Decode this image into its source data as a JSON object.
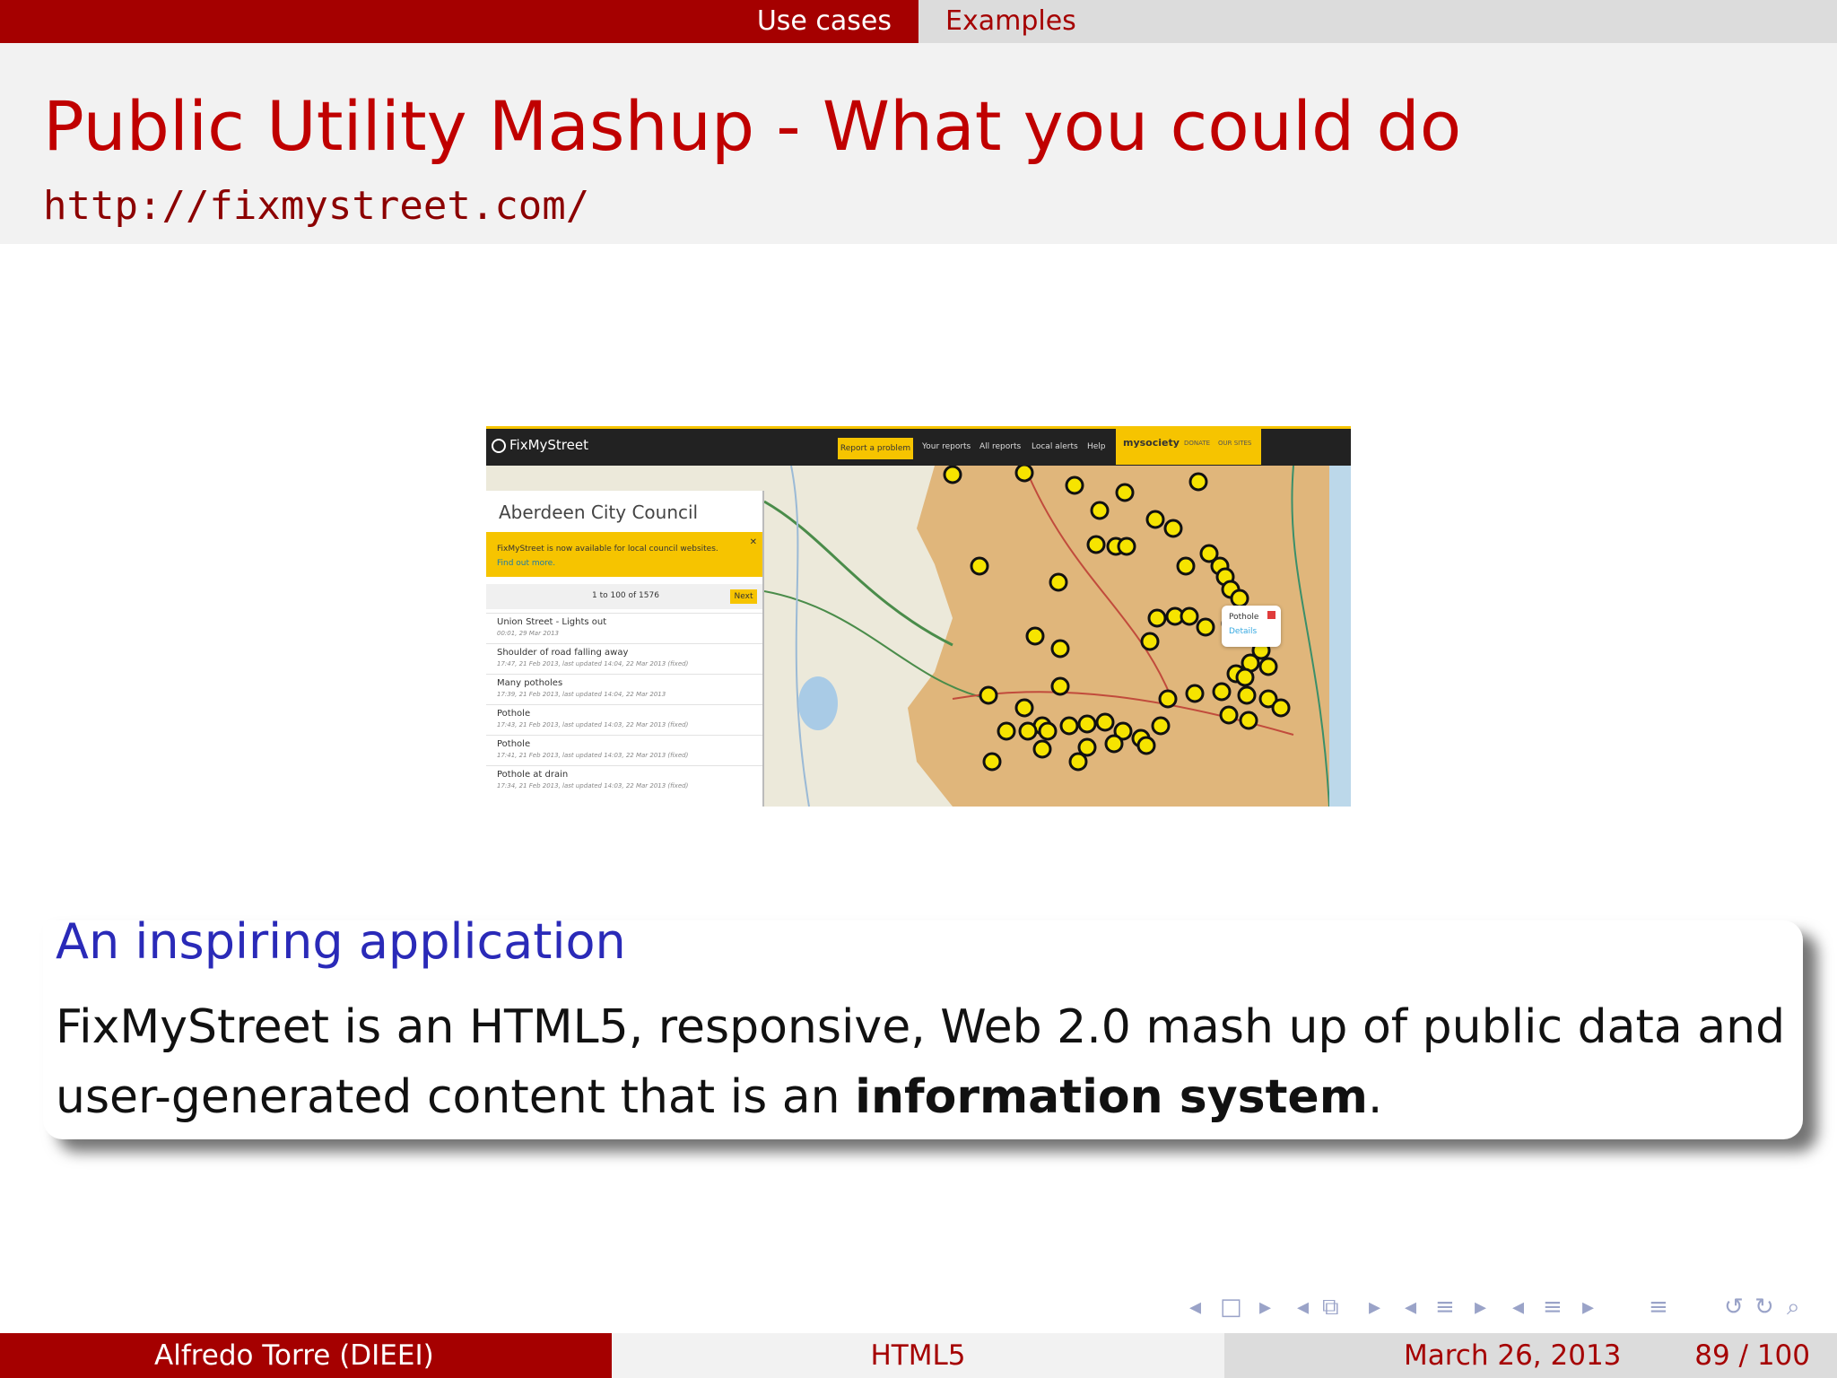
{
  "nav": {
    "section": "Use cases",
    "subsection": "Examples"
  },
  "title": "Public Utility Mashup - What you could do",
  "subtitle": "http://fixmystreet.com/",
  "screenshot": {
    "logo": "FixMyStreet",
    "nav": [
      "Report a problem",
      "Your reports",
      "All reports",
      "Local alerts",
      "Help"
    ],
    "mysociety": "mysociety",
    "mysociety_links": [
      "DONATE",
      "OUR SITES"
    ],
    "council": "Aberdeen City Council",
    "notice": "FixMyStreet is now available for local council websites.",
    "notice_link": "Find out more.",
    "pager": "1 to 100 of 1576",
    "next": "Next",
    "reports": [
      {
        "title": "Union Street - Lights out",
        "meta": "00:01, 29 Mar 2013"
      },
      {
        "title": "Shoulder of road falling away",
        "meta": "17:47, 21 Feb 2013, last updated 14:04, 22 Mar 2013 (fixed)"
      },
      {
        "title": "Many potholes",
        "meta": "17:39, 21 Feb 2013, last updated 14:04, 22 Mar 2013"
      },
      {
        "title": "Pothole",
        "meta": "17:43, 21 Feb 2013, last updated 14:03, 22 Mar 2013 (fixed)"
      },
      {
        "title": "Pothole",
        "meta": "17:41, 21 Feb 2013, last updated 14:03, 22 Mar 2013 (fixed)"
      },
      {
        "title": "Pothole at drain",
        "meta": "17:34, 21 Feb 2013, last updated 14:03, 22 Mar 2013 (fixed)"
      }
    ],
    "popup_title": "Pothole",
    "popup_link": "Details"
  },
  "block": {
    "title": "An inspiring application",
    "body_prefix": "FixMyStreet is an HTML5, responsive, Web 2.0 mash up of public data and user-generated content that is an ",
    "body_bold": "information system",
    "body_suffix": "."
  },
  "footer": {
    "author": "Alfredo Torre  (DIEEI)",
    "short_title": "HTML5",
    "date": "March 26, 2013",
    "page": "89 / 100"
  },
  "colors": {
    "accent": "#a50000",
    "title": "#c00000",
    "block_title": "#2a2ab8",
    "app_yellow": "#f6c400"
  }
}
